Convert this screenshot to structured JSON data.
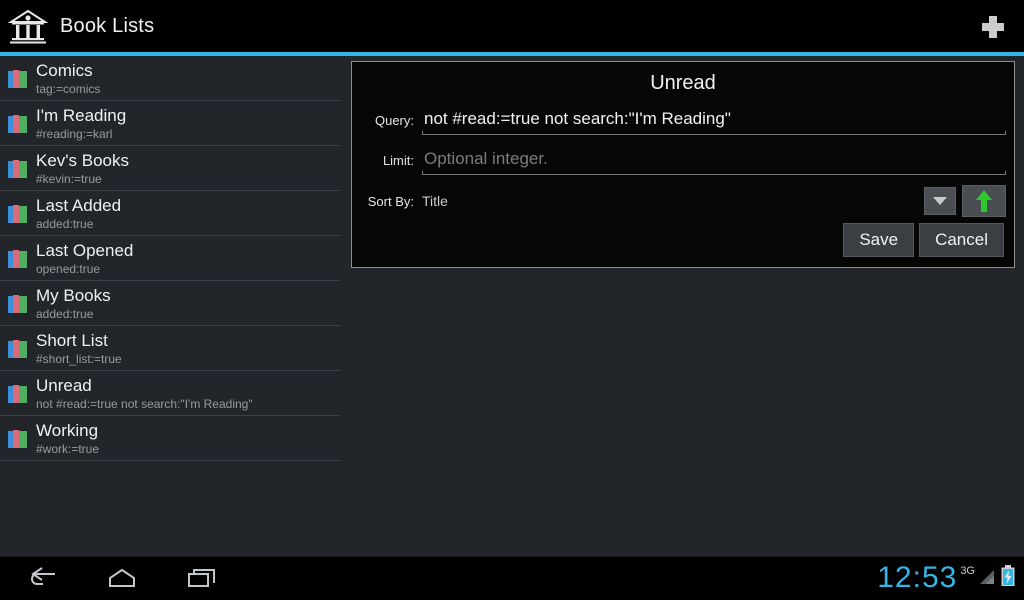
{
  "header": {
    "title": "Book Lists",
    "app_icon": "library-building-icon",
    "action_icon": "add-plus-icon",
    "accent_color": "#33b5e5"
  },
  "sidebar": {
    "items": [
      {
        "title": "Comics",
        "query": "tag:=comics",
        "icon": "books-icon"
      },
      {
        "title": "I'm Reading",
        "query": "#reading:=karl",
        "icon": "books-icon"
      },
      {
        "title": "Kev's Books",
        "query": "#kevin:=true",
        "icon": "books-icon"
      },
      {
        "title": "Last Added",
        "query": "added:true",
        "icon": "books-icon"
      },
      {
        "title": "Last Opened",
        "query": "opened:true",
        "icon": "books-icon"
      },
      {
        "title": "My Books",
        "query": "added:true",
        "icon": "books-icon"
      },
      {
        "title": "Short List",
        "query": "#short_list:=true",
        "icon": "books-icon"
      },
      {
        "title": "Unread",
        "query": "not #read:=true not search:\"I'm Reading\"",
        "icon": "books-icon"
      },
      {
        "title": "Working",
        "query": "#work:=true",
        "icon": "books-icon"
      }
    ]
  },
  "dialog": {
    "title": "Unread",
    "query": {
      "label": "Query:",
      "value": "not #read:=true not search:\"I'm Reading\""
    },
    "limit": {
      "label": "Limit:",
      "value": "",
      "placeholder": "Optional integer."
    },
    "sort": {
      "label": "Sort By:",
      "value": "Title",
      "dropdown_icon": "chevron-down-icon",
      "direction_icon": "arrow-up-icon",
      "direction_color": "#2fc92f"
    },
    "save_label": "Save",
    "cancel_label": "Cancel"
  },
  "navbar": {
    "back_icon": "back-arrow-icon",
    "home_icon": "home-icon",
    "recents_icon": "recent-apps-icon"
  },
  "status": {
    "time": "12:53",
    "network": "3G",
    "signal_icon": "signal-bars-icon",
    "battery_icon": "battery-charging-icon",
    "clock_color": "#33b5e5"
  }
}
